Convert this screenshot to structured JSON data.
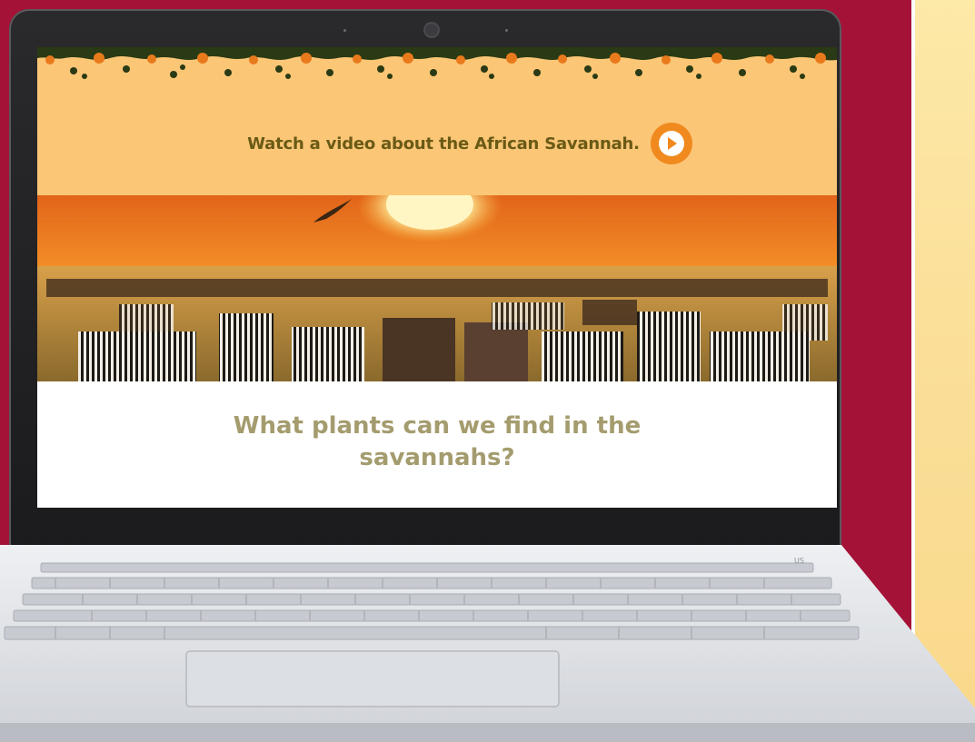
{
  "page": {
    "background_color": "#a51238",
    "side_panel_color": "#fbe09a"
  },
  "screen": {
    "video_banner": {
      "text": "Watch a video about the African Savannah.",
      "play_icon": "play-circle-icon",
      "accent_color": "#f08a1e",
      "text_color": "#6a5a16",
      "background_color": "#fbc676"
    },
    "hero_image": {
      "description_icon": "savannah-zebra-photo"
    },
    "heading": {
      "line1": "What plants can we find in the",
      "line2": "savannahs?",
      "color": "#a49c6e"
    }
  },
  "keyboard": {
    "locale_badge": "US"
  }
}
